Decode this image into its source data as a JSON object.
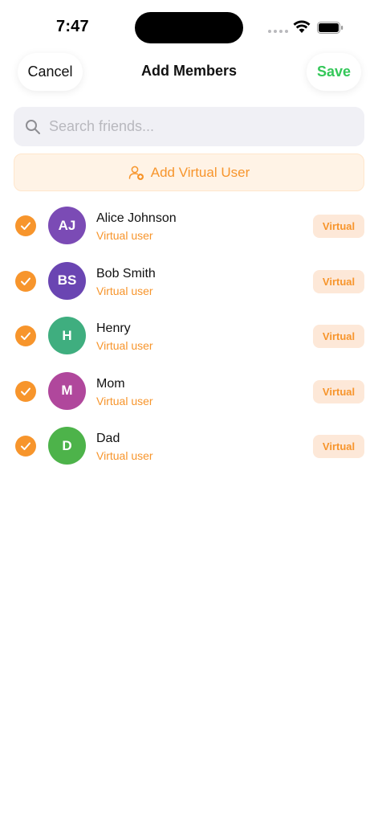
{
  "status_bar": {
    "time": "7:47"
  },
  "nav": {
    "cancel_label": "Cancel",
    "title": "Add Members",
    "save_label": "Save"
  },
  "search": {
    "placeholder": "Search friends...",
    "value": ""
  },
  "add_virtual": {
    "label": "Add Virtual User",
    "icon": "person-add-icon"
  },
  "members": [
    {
      "initials": "AJ",
      "name": "Alice Johnson",
      "subtitle": "Virtual user",
      "badge": "Virtual",
      "selected": true,
      "color": "#7b4bb5"
    },
    {
      "initials": "BS",
      "name": "Bob Smith",
      "subtitle": "Virtual user",
      "badge": "Virtual",
      "selected": true,
      "color": "#6a45b2"
    },
    {
      "initials": "H",
      "name": "Henry",
      "subtitle": "Virtual user",
      "badge": "Virtual",
      "selected": true,
      "color": "#3fae7f"
    },
    {
      "initials": "M",
      "name": "Mom",
      "subtitle": "Virtual user",
      "badge": "Virtual",
      "selected": true,
      "color": "#b0479c"
    },
    {
      "initials": "D",
      "name": "Dad",
      "subtitle": "Virtual user",
      "badge": "Virtual",
      "selected": true,
      "color": "#4db34a"
    }
  ],
  "colors": {
    "accent": "#f7952c",
    "save": "#34c759",
    "search_bg": "#f0f0f5",
    "add_bg": "#fff3e6",
    "badge_bg": "#fde8d8"
  }
}
